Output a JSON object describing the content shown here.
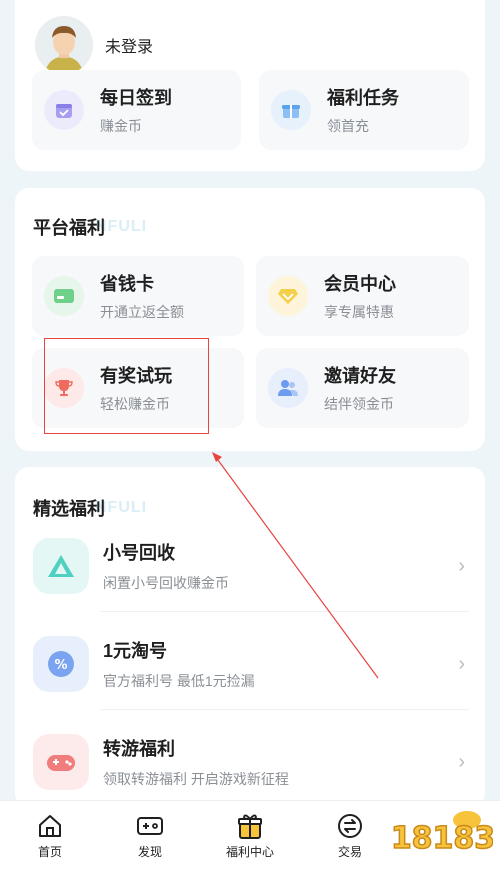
{
  "user": {
    "login_text": "未登录"
  },
  "quick": [
    {
      "title": "每日签到",
      "sub": "赚金币"
    },
    {
      "title": "福利任务",
      "sub": "领首充"
    }
  ],
  "platform": {
    "title": "平台福利",
    "watermark": "NFULI",
    "items": [
      {
        "title": "省钱卡",
        "sub": "开通立返全额"
      },
      {
        "title": "会员中心",
        "sub": "享专属特惠"
      },
      {
        "title": "有奖试玩",
        "sub": "轻松赚金币"
      },
      {
        "title": "邀请好友",
        "sub": "结伴领金币"
      }
    ]
  },
  "featured": {
    "title": "精选福利",
    "watermark": "NFULI",
    "items": [
      {
        "title": "小号回收",
        "sub": "闲置小号回收赚金币"
      },
      {
        "title": "1元淘号",
        "sub": "官方福利号 最低1元捡漏"
      },
      {
        "title": "转游福利",
        "sub": "领取转游福利 开启游戏新征程"
      }
    ]
  },
  "tabs": [
    {
      "label": "首页",
      "icon": "home-icon"
    },
    {
      "label": "发现",
      "icon": "gamepad-icon"
    },
    {
      "label": "福利中心",
      "icon": "gift-icon"
    },
    {
      "label": "交易",
      "icon": "swap-icon"
    }
  ],
  "colors": {
    "annotation": "#e8433f",
    "calendar": "#8a7ee8",
    "gift": "#5aa3ee",
    "card": "#4cc46a",
    "vip": "#f1c232",
    "trophy": "#e6544a",
    "friends": "#5b8fe8"
  }
}
